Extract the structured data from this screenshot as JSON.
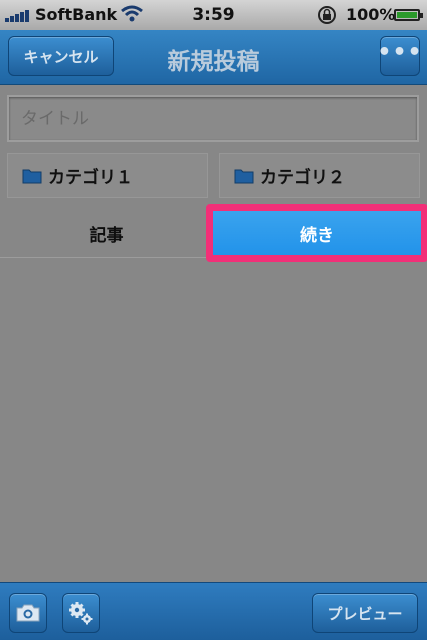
{
  "status_bar": {
    "carrier": "SoftBank",
    "time": "3:59",
    "battery": "100%",
    "battery_level": 1.0,
    "icons": [
      "signal-icon",
      "wifi-icon",
      "rotation-lock-icon",
      "battery-icon"
    ]
  },
  "nav": {
    "cancel_label": "キャンセル",
    "title": "新規投稿",
    "more_label": "•••"
  },
  "title_field": {
    "placeholder": "タイトル",
    "value": ""
  },
  "categories": [
    {
      "label": "カテゴリ１",
      "icon": "folder-icon"
    },
    {
      "label": "カテゴリ２",
      "icon": "folder-icon"
    }
  ],
  "tabs": {
    "article_label": "記事",
    "continue_label": "続き",
    "selected": "continue"
  },
  "toolbar": {
    "camera_icon": "camera-icon",
    "settings_icon": "settings-icon",
    "preview_label": "プレビュー"
  },
  "colors": {
    "nav_blue": "#2a75b8",
    "selected_tab": "#2a9aec",
    "highlight": "#f22f78",
    "overlay_gray": "#878787"
  }
}
